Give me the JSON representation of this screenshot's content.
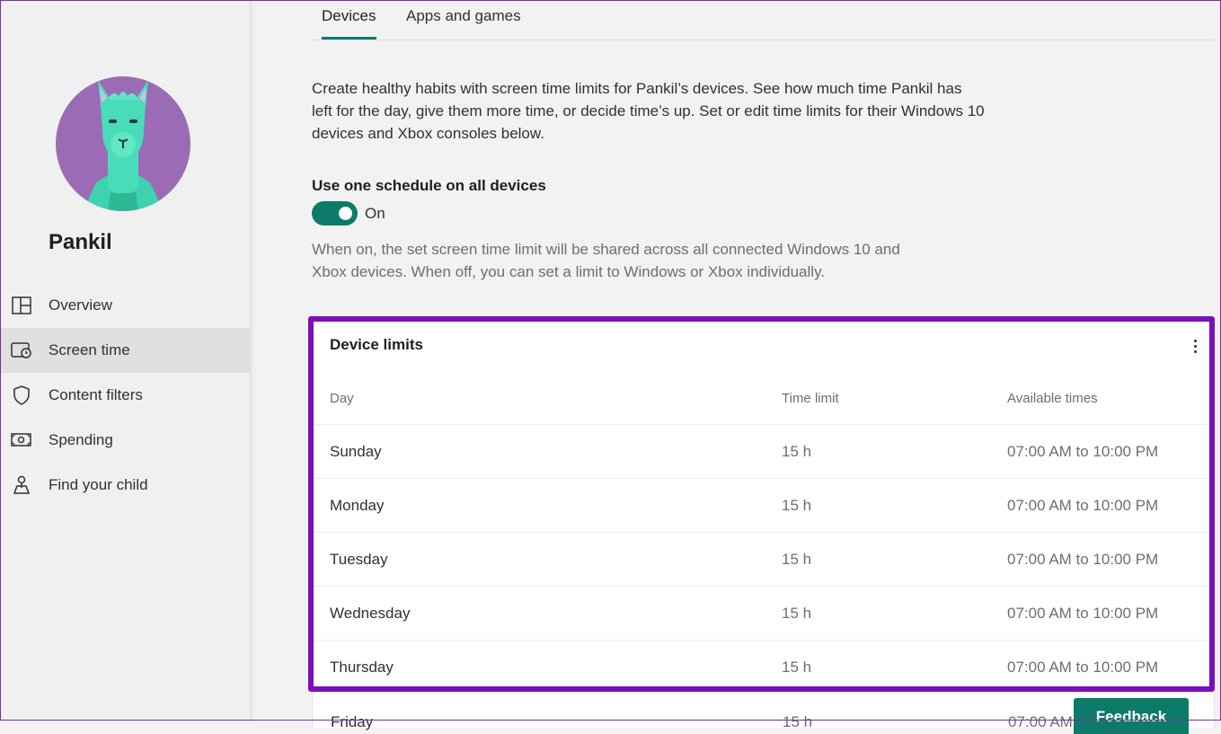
{
  "profile": {
    "name": "Pankil"
  },
  "sidebar": {
    "items": [
      {
        "label": "Overview",
        "icon": "grid-icon"
      },
      {
        "label": "Screen time",
        "icon": "screen-time-icon"
      },
      {
        "label": "Content filters",
        "icon": "shield-icon"
      },
      {
        "label": "Spending",
        "icon": "money-icon"
      },
      {
        "label": "Find your child",
        "icon": "location-icon"
      }
    ]
  },
  "tabs": [
    {
      "label": "Devices"
    },
    {
      "label": "Apps and games"
    }
  ],
  "intro": "Create healthy habits with screen time limits for Pankil’s devices. See how much time Pankil has left for the day, give them more time, or decide time’s up. Set or edit time limits for their Windows 10 devices and Xbox consoles below.",
  "schedule": {
    "title": "Use one schedule on all devices",
    "toggle_label": "On",
    "help": "When on, the set screen time limit will be shared across all connected Windows 10 and Xbox devices. When off, you can set a limit to Windows or Xbox individually."
  },
  "device_limits": {
    "title": "Device limits",
    "columns": [
      "Day",
      "Time limit",
      "Available times"
    ],
    "rows": [
      {
        "day": "Sunday",
        "limit": "15 h",
        "times": "07:00 AM to 10:00 PM"
      },
      {
        "day": "Monday",
        "limit": "15 h",
        "times": "07:00 AM to 10:00 PM"
      },
      {
        "day": "Tuesday",
        "limit": "15 h",
        "times": "07:00 AM to 10:00 PM"
      },
      {
        "day": "Wednesday",
        "limit": "15 h",
        "times": "07:00 AM to 10:00 PM"
      },
      {
        "day": "Thursday",
        "limit": "15 h",
        "times": "07:00 AM to 10:00 PM"
      }
    ],
    "partial_row": {
      "day": "Friday",
      "limit": "15 h",
      "times": "07:00 AM"
    }
  },
  "feedback_label": "Feedback",
  "colors": {
    "accent": "#0e7a6a",
    "highlight": "#7b0fb8",
    "avatar_bg": "#9b6bb5",
    "llama": "#3fd2b0"
  }
}
